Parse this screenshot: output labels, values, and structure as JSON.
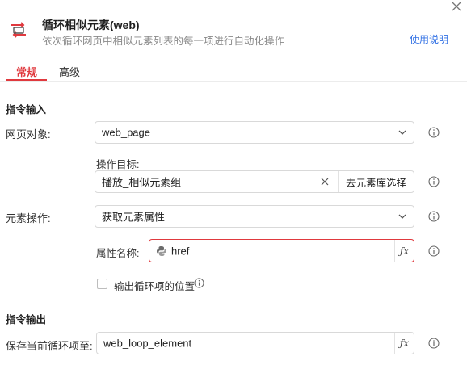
{
  "header": {
    "title": "循环相似元素(web)",
    "subtitle": "依次循环网页中相似元素列表的每一项进行自动化操作",
    "help_link": "使用说明"
  },
  "tabs": [
    {
      "label": "常规",
      "active": true
    },
    {
      "label": "高级",
      "active": false
    }
  ],
  "sections": {
    "input": "指令输入",
    "output": "指令输出"
  },
  "fields": {
    "web_object": {
      "label": "网页对象:",
      "value": "web_page"
    },
    "target": {
      "label": "操作目标:",
      "value": "播放_相似元素组",
      "library_button": "去元素库选择"
    },
    "element_action": {
      "label": "元素操作:",
      "value": "获取元素属性"
    },
    "attribute_name": {
      "label": "属性名称:",
      "value": "href"
    },
    "output_index": {
      "label": "输出循环项的位置",
      "checked": false
    },
    "save_current": {
      "label": "保存当前循环项至:",
      "value": "web_loop_element"
    }
  },
  "colors": {
    "accent": "#e0393e",
    "link": "#2f6fe4"
  },
  "icons": {
    "header": "loop-element-icon",
    "close": "close-icon",
    "dropdown": "chevron-down-icon",
    "info": "info-icon",
    "python": "python-icon",
    "fx": "fx-icon",
    "clear": "clear-icon"
  }
}
